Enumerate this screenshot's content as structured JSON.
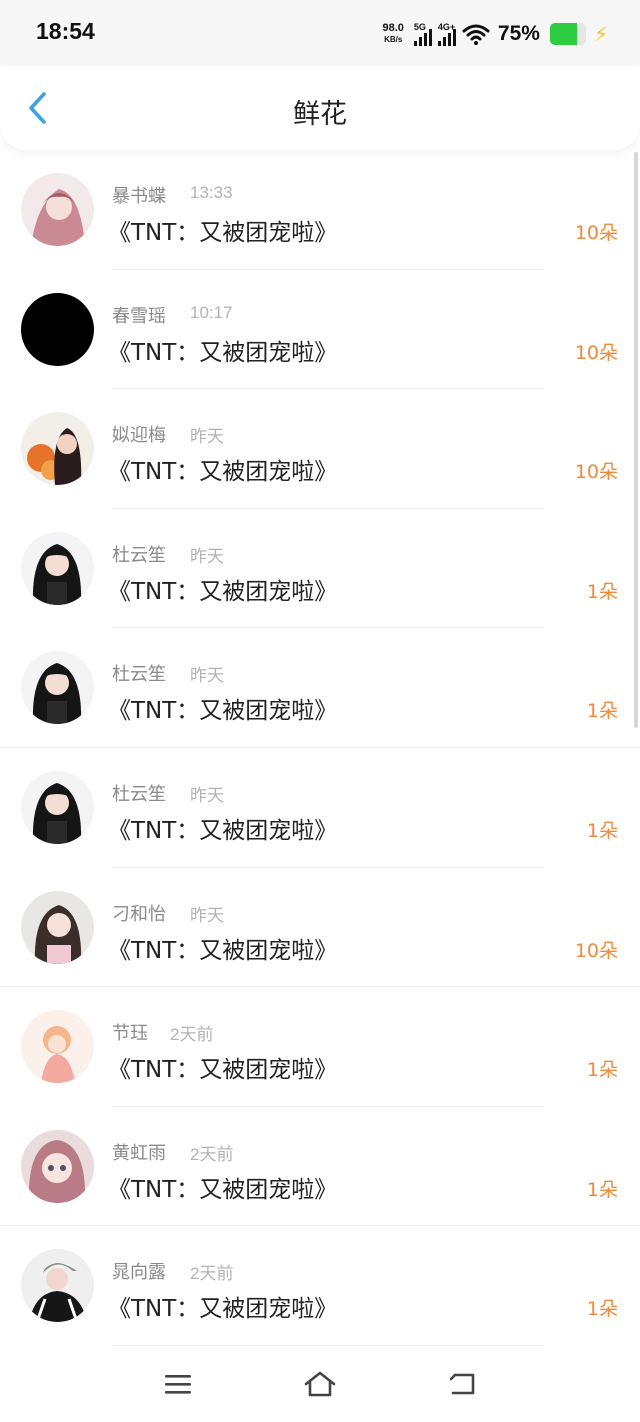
{
  "status_bar": {
    "time": "18:54",
    "net_speed_value": "98.0",
    "net_speed_unit": "KB/s",
    "signal1_label": "5G",
    "signal2_label": "4G+",
    "battery_percent": "75%",
    "battery_level": 0.75,
    "battery_color": "#2ecc40"
  },
  "header": {
    "title": "鲜花",
    "back_icon": "chevron-left-icon",
    "accent_color": "#3ba0e6"
  },
  "rows": [
    {
      "name": "暴书蝶",
      "time": "13:33",
      "book": "《TNT：又被团宠啦》",
      "count": "10朵",
      "avatar": "anime-girl-pink"
    },
    {
      "name": "春雪瑶",
      "time": "10:17",
      "book": "《TNT：又被团宠啦》",
      "count": "10朵",
      "avatar": "black-circle"
    },
    {
      "name": "姒迎梅",
      "time": "昨天",
      "book": "《TNT：又被团宠啦》",
      "count": "10朵",
      "avatar": "girl-flowers"
    },
    {
      "name": "杜云笙",
      "time": "昨天",
      "book": "《TNT：又被团宠啦》",
      "count": "1朵",
      "avatar": "girl-dark-hair"
    },
    {
      "name": "杜云笙",
      "time": "昨天",
      "book": "《TNT：又被团宠啦》",
      "count": "1朵",
      "avatar": "girl-dark-hair"
    },
    {
      "name": "杜云笙",
      "time": "昨天",
      "book": "《TNT：又被团宠啦》",
      "count": "1朵",
      "avatar": "girl-dark-hair"
    },
    {
      "name": "刁和怡",
      "time": "昨天",
      "book": "《TNT：又被团宠啦》",
      "count": "10朵",
      "avatar": "girl-light"
    },
    {
      "name": "节珏",
      "time": "2天前",
      "book": "《TNT：又被团宠啦》",
      "count": "1朵",
      "avatar": "anime-girl-orange"
    },
    {
      "name": "黄虹雨",
      "time": "2天前",
      "book": "《TNT：又被团宠啦》",
      "count": "1朵",
      "avatar": "anime-girl-pink-hair"
    },
    {
      "name": "晁向露",
      "time": "2天前",
      "book": "《TNT：又被团宠啦》",
      "count": "1朵",
      "avatar": "person-cap"
    }
  ],
  "count_color": "#ef8a3c",
  "nav_bar": {
    "menu_icon": "menu-icon",
    "home_icon": "home-icon",
    "back_icon": "return-icon"
  }
}
